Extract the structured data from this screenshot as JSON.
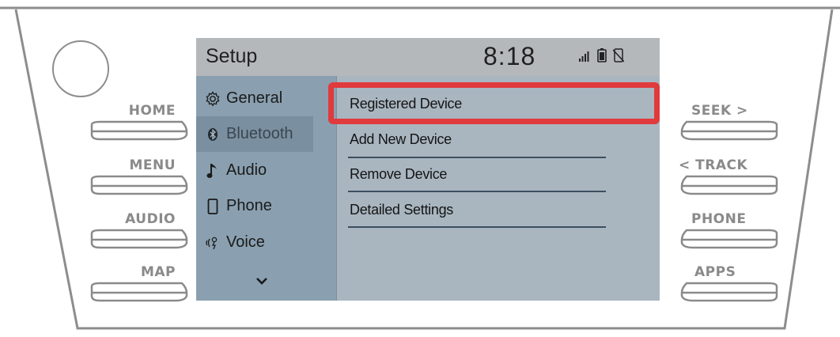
{
  "screen": {
    "title": "Setup",
    "clock": "8:18",
    "status_icons": [
      "signal-icon",
      "battery-icon",
      "no-phone-icon"
    ]
  },
  "sidebar": {
    "items": [
      {
        "label": "General",
        "icon": "gear-icon",
        "active": false
      },
      {
        "label": "Bluetooth",
        "icon": "bluetooth-icon",
        "active": true
      },
      {
        "label": "Audio",
        "icon": "music-note-icon",
        "active": false
      },
      {
        "label": "Phone",
        "icon": "phone-icon",
        "active": false
      },
      {
        "label": "Voice",
        "icon": "voice-icon",
        "active": false
      }
    ],
    "more_icon": "chevron-down-icon"
  },
  "menu": {
    "items": [
      {
        "label": "Registered Device",
        "highlighted": true
      },
      {
        "label": "Add New Device",
        "highlighted": false
      },
      {
        "label": "Remove Device",
        "highlighted": false
      },
      {
        "label": "Detailed Settings",
        "highlighted": false
      }
    ]
  },
  "hardware": {
    "left_buttons": [
      "HOME",
      "MENU",
      "AUDIO",
      "MAP"
    ],
    "right_buttons": [
      "SEEK >",
      "< TRACK",
      "PHONE",
      "APPS"
    ]
  },
  "colors": {
    "highlight_frame": "#e03a3c",
    "screen_background": "#a9b6c0",
    "sidebar_background": "#8aa0b0"
  }
}
